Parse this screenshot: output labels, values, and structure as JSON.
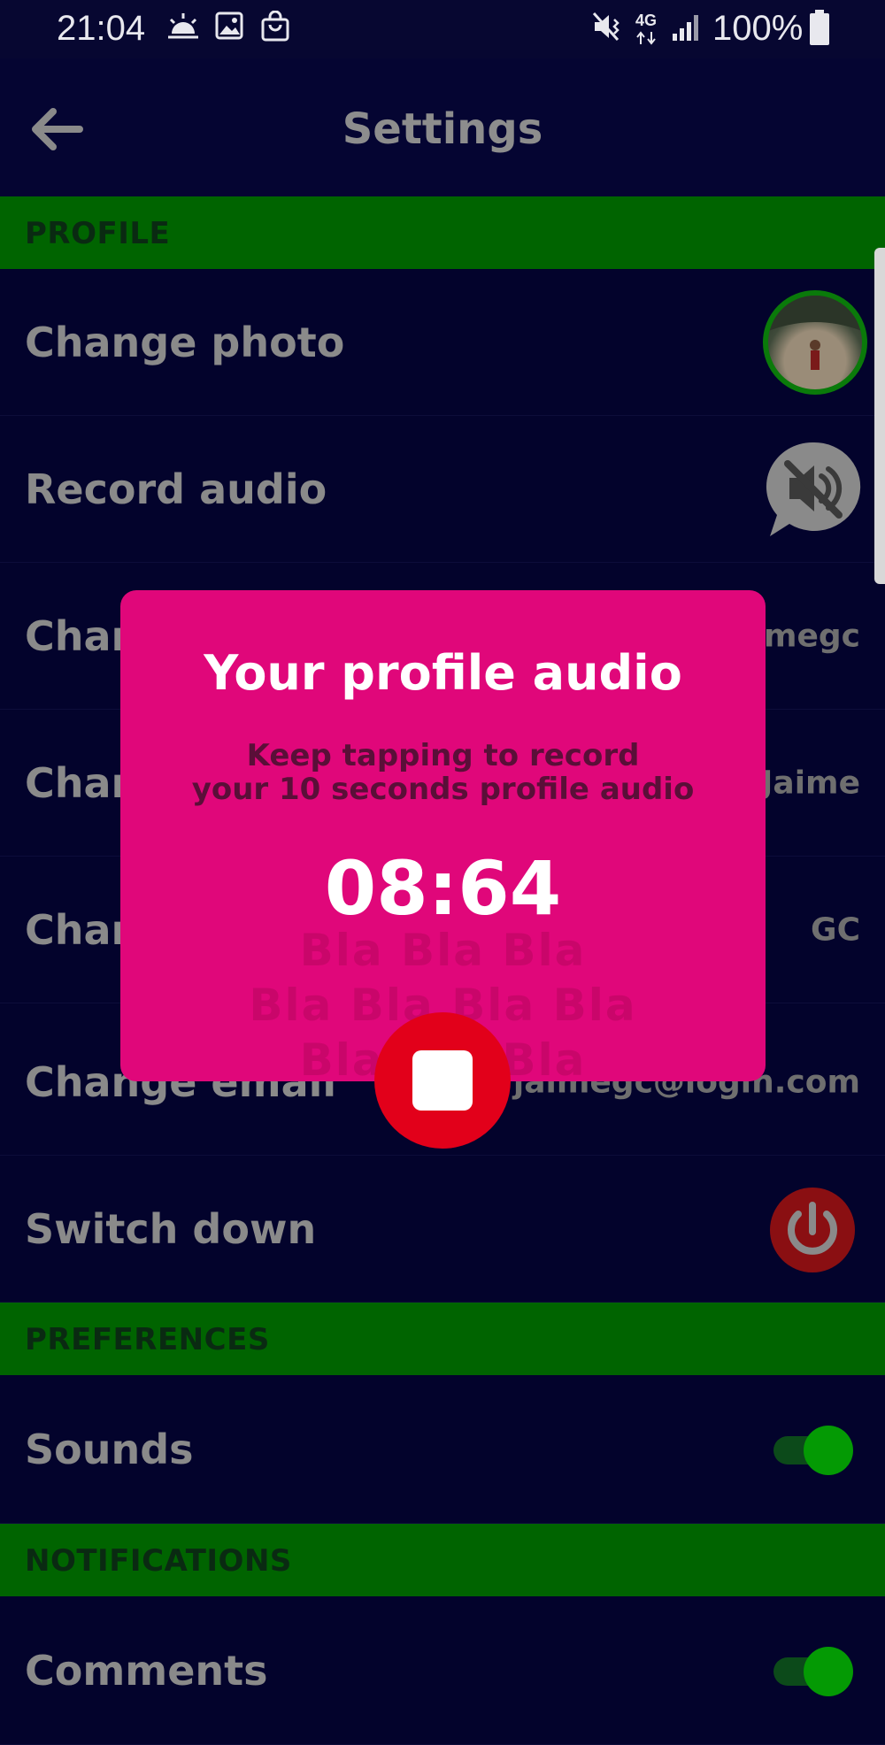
{
  "status_bar": {
    "time": "21:04",
    "network": "4G",
    "battery": "100%",
    "icons": [
      "weather-icon",
      "gallery-icon",
      "shopping-bag-icon",
      "mute-icon",
      "signal-icon",
      "battery-icon"
    ]
  },
  "app_bar": {
    "title": "Settings",
    "back_icon": "arrow-left-icon"
  },
  "sections": {
    "profile": "PROFILE",
    "preferences": "PREFERENCES",
    "notifications": "NOTIFICATIONS"
  },
  "rows": {
    "change_photo": {
      "label": "Change photo"
    },
    "record_audio": {
      "label": "Record audio"
    },
    "change_username": {
      "label": "Change",
      "value": "jaimegc"
    },
    "change_name": {
      "label": "Change",
      "value": "Jaime"
    },
    "change_initials": {
      "label": "Change",
      "value": "GC"
    },
    "change_email": {
      "label": "Change email",
      "value": "jaimegc@login.com"
    },
    "switch_down": {
      "label": "Switch down"
    },
    "sounds": {
      "label": "Sounds",
      "enabled": true
    },
    "comments": {
      "label": "Comments",
      "enabled": true
    }
  },
  "dialog": {
    "title": "Your profile audio",
    "subtitle_line1": "Keep tapping to record",
    "subtitle_line2": "your 10 seconds profile audio",
    "timer": "08:64",
    "bla_line1": "Bla Bla Bla",
    "bla_line2": "Bla Bla Bla Bla",
    "bla_line3": "Bla Bla Bla",
    "stop_icon": "stop-icon"
  },
  "colors": {
    "background": "#03032c",
    "section_header": "#006400",
    "dialog": "#e0077a",
    "stop_button": "#e2001a",
    "toggle_on": "#049a04"
  }
}
